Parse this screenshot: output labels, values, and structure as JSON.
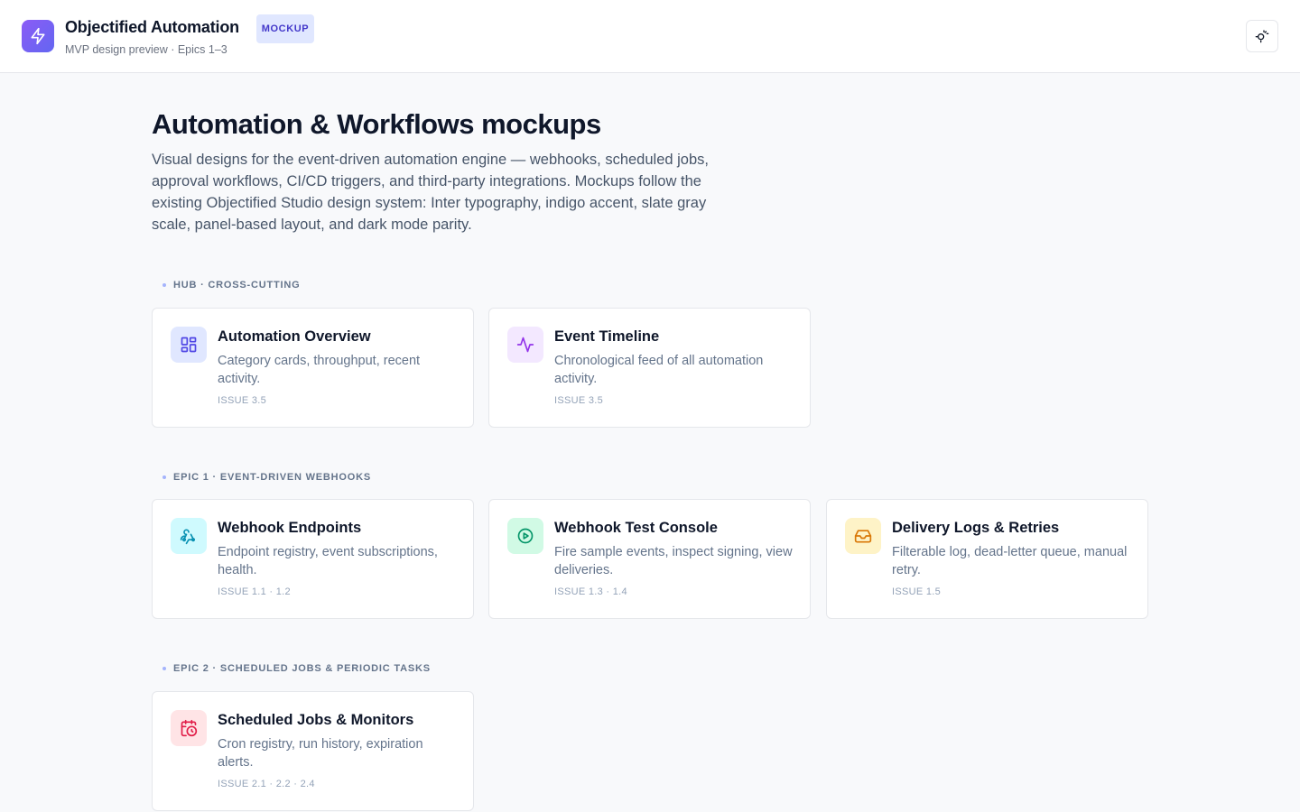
{
  "header": {
    "title": "Objectified Automation",
    "badge": "MOCKUP",
    "subtitle": "MVP design preview · Epics 1–3",
    "logo_icon": "lightning-bolt-icon",
    "theme_toggle_icon": "theme-toggle-icon"
  },
  "page": {
    "title": "Automation & Workflows mockups",
    "description": "Visual designs for the event-driven automation engine — webhooks, scheduled jobs, approval workflows, CI/CD triggers, and third-party integrations. Mockups follow the existing Objectified Studio design system: Inter typography, indigo accent, slate gray scale, panel-based layout, and dark mode parity."
  },
  "sections": [
    {
      "label": "HUB · CROSS-CUTTING",
      "cards": [
        {
          "title": "Automation Overview",
          "desc": "Category cards, throughput, recent activity.",
          "issue": "ISSUE 3.5",
          "icon": "grid-icon",
          "accent": "#4f46e5"
        },
        {
          "title": "Event Timeline",
          "desc": "Chronological feed of all automation activity.",
          "issue": "ISSUE 3.5",
          "icon": "activity-icon",
          "accent": "#9333ea"
        }
      ]
    },
    {
      "label": "EPIC 1 · EVENT-DRIVEN WEBHOOKS",
      "cards": [
        {
          "title": "Webhook Endpoints",
          "desc": "Endpoint registry, event subscriptions, health.",
          "issue": "ISSUE 1.1 · 1.2",
          "icon": "webhook-icon",
          "accent": "#0891b2"
        },
        {
          "title": "Webhook Test Console",
          "desc": "Fire sample events, inspect signing, view deliveries.",
          "issue": "ISSUE 1.3 · 1.4",
          "icon": "play-circle-icon",
          "accent": "#059669"
        },
        {
          "title": "Delivery Logs & Retries",
          "desc": "Filterable log, dead-letter queue, manual retry.",
          "issue": "ISSUE 1.5",
          "icon": "inbox-icon",
          "accent": "#d97706"
        }
      ]
    },
    {
      "label": "EPIC 2 · SCHEDULED JOBS & PERIODIC TASKS",
      "cards": [
        {
          "title": "Scheduled Jobs & Monitors",
          "desc": "Cron registry, run history, expiration alerts.",
          "issue": "ISSUE 2.1 · 2.2 · 2.4",
          "icon": "calendar-clock-icon",
          "accent": "#e11d48"
        }
      ]
    }
  ],
  "colors": {
    "accent": "#6366f1",
    "badge_bg": "#e0e7ff",
    "badge_text": "#4338ca"
  }
}
